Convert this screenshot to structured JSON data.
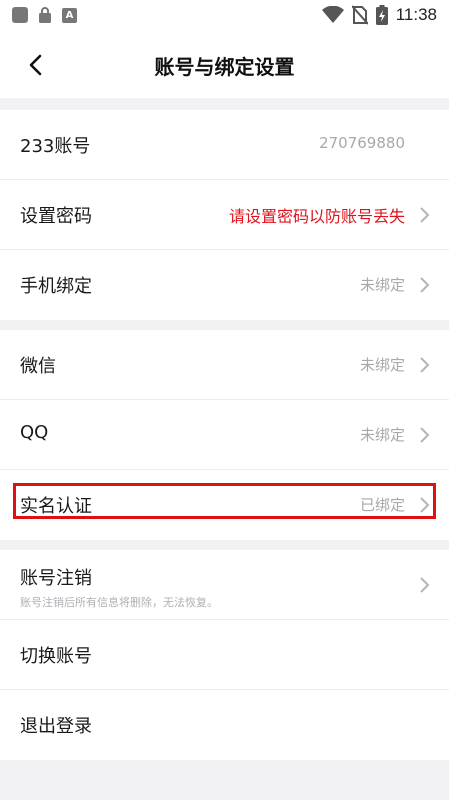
{
  "status_bar": {
    "time": "11:38",
    "a_glyph": "A"
  },
  "nav": {
    "title": "账号与绑定设置"
  },
  "group1": [
    {
      "label": "233账号",
      "value": "270769880"
    },
    {
      "label": "设置密码",
      "value": "请设置密码以防账号丢失"
    },
    {
      "label": "手机绑定",
      "value": "未绑定"
    }
  ],
  "group2": [
    {
      "label": "微信",
      "value": "未绑定"
    },
    {
      "label": "QQ",
      "value": "未绑定"
    },
    {
      "label": "实名认证",
      "value": "已绑定"
    }
  ],
  "group3": [
    {
      "label": "账号注销",
      "subtitle": "账号注销后所有信息将删除，无法恢复。"
    },
    {
      "label": "切换账号"
    },
    {
      "label": "退出登录"
    }
  ],
  "colors": {
    "warning": "#e0121d",
    "highlight_border": "#e01010",
    "muted": "#a8a8ad",
    "background": "#f2f2f4"
  },
  "icons": [
    "back-arrow-icon",
    "chevron-right-icon",
    "wifi-icon",
    "no-sim-icon",
    "battery-charging-icon"
  ]
}
